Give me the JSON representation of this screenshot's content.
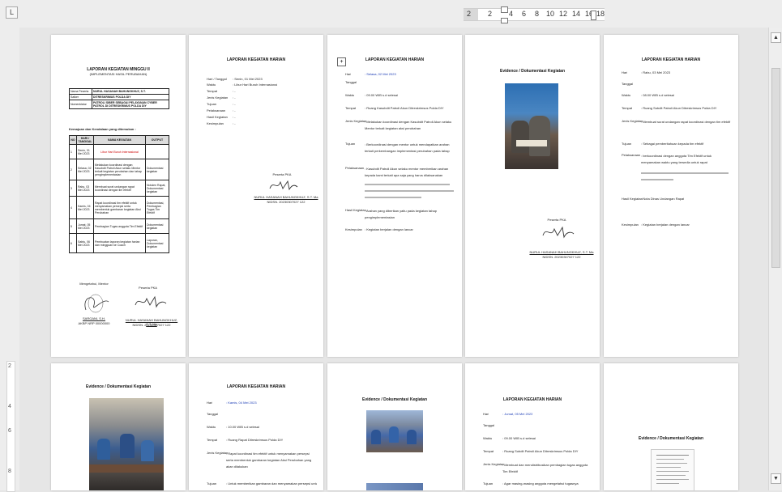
{
  "ruler": {
    "tab_selector": "L",
    "top_numbers": [
      "2",
      "2",
      "4",
      "6",
      "8",
      "10",
      "12",
      "14",
      "16",
      "18"
    ],
    "left_numbers": [
      "2",
      "4",
      "6",
      "8"
    ]
  },
  "scrollbar": {
    "up": "▲",
    "down": "▼"
  },
  "pages": {
    "p1": {
      "title1": "LAPORAN KEGIATAN MINGGU II",
      "title2": "(IMPLEMENTASI HASIL PERUBAHAN)",
      "id_rows": [
        [
          "Nama Peserta",
          "NURUL HASANAH BAHUNGKHUZ, S.T."
        ],
        [
          "Satker",
          "DITRESKRIMUS POLDA DIY"
        ],
        [
          "Nomenklatur",
          "PATROLI SIBER SEBAGAI PELAYANAN CYBER PATROL DI DITRESKRIMUS POLDA DIY"
        ]
      ],
      "sub": "Kemajuan dan Kendalaan yang ditemukan :",
      "headers": [
        "NO",
        "HARI / TANGGAL",
        "NAMA KEGIATAN",
        "OUTPUT"
      ],
      "rows": [
        [
          "1",
          "Senin, 01 Mei 2023",
          "Libur Hari Buruh Internasional",
          ""
        ],
        [
          "2",
          "Selasa, 02 Mei 2023",
          "Melakukan koordinasi dengan Kasubdit Patroli Akun selaku Mentor terkait kegiatan perubahan dan tahap pengimplementasian",
          "Dokumentasi kegiatan"
        ],
        [
          "3",
          "Rabu, 03 Mei 2023",
          "Membuat surat undangan rapat koordinasi dengan tim efektif",
          "Notulen Rapat, Dokumentasi kegiatan"
        ],
        [
          "4",
          "Kamis, 04 Mei 2023",
          "Rapat koordinasi tim efektif untuk menyamakan persepsi serta membentuk gambaran kegiatan Aksi Perubahan",
          "Dokumentasi, Pembagian Tugas Tim Efektif"
        ],
        [
          "5",
          "Jumat, 05 Mei 2023",
          "Pembagian Tugas anggota Tim Efektif",
          "Dokumentasi kegiatan"
        ],
        [
          "6",
          "Sabtu, 06 Mei 2023",
          "Pembuatan laporan kegiatan harian dan mingguan ke Coach",
          "Laporan, Dokumentasi kegiatan"
        ]
      ],
      "sign_left": "Mengetahui, Mentor",
      "sign_right": "Peserta PKA",
      "name_left": "SARGANI, S.H.",
      "nrp_left": "AKBP NRP 00000000",
      "name_right": "NURUL HASANAH BAHUNGKHUZ, S.T. Ma",
      "nrp_right": "NIDSN. 20230307027 122"
    },
    "p2": {
      "title": "LAPORAN KEGIATAN HARIAN",
      "fields": [
        [
          "Hari / Tanggal",
          ": Senin, 01 Mei 2023"
        ],
        [
          "Waktu",
          ": Libur Hari Buruh Internasional"
        ],
        [
          "Tempat",
          ": -"
        ],
        [
          "Jenis Kegiatan",
          ": -"
        ],
        [
          "Tujuan",
          ": -"
        ],
        [
          "Pelaksanaan",
          ": -"
        ],
        [
          "Hasil Kegiatan",
          ": -"
        ],
        [
          "Kesimpulan",
          ": -"
        ]
      ],
      "signer_label": "Peserta PKA",
      "signer_name": "NURUL HASANAH BAHUNGKHUZ, S.T. Ma",
      "signer_nrp": "NIDSN. 20230307027 122"
    },
    "p3": {
      "title": "LAPORAN KEGIATAN HARIAN",
      "fields": [
        [
          "Hari",
          ": Selasa, 02 Mei 2023"
        ],
        [
          "Tanggal",
          ""
        ],
        [
          "Waktu",
          ": 09.00 WIB s.d selesai"
        ],
        [
          "Tempat",
          ": Ruang Kasubdit Patroli Akun Ditreskrimsus Polda DIY"
        ],
        [
          "Jenis Kegiatan",
          ": Melakukan koordinasi dengan Kasubdit Patroli Akun selaku Mentor terkait kegiatan aksi perubahan"
        ],
        [
          "Tujuan",
          ": Berkoordinasi dengan mentor untuk mendapatkan arahan terkait perkembangan implementasi perubahan pada tahap pengimplementasian"
        ],
        [
          "Pelaksanaan",
          ": Kasubdit Patroli Akun selaku mentor memberikan arahan kepada kami terkait apa saja yang harus dilaksanakan"
        ],
        [
          "Hasil Kegiatan",
          ": Arahan yang diberikan yaitu pada kegiatan tahap pengimplementasian"
        ],
        [
          "Kesimpulan",
          ": Kegiatan berjalan dengan lancar"
        ]
      ],
      "icon_label": "+"
    },
    "p4": {
      "title": "Evidence / Dokumentasi Kegiatan",
      "signer_label": "Peserta PKA",
      "signer_name": "NURUL HASANAH BAHUNGKHUZ, S.T. Ma",
      "signer_nrp": "NIDSN. 20230307027 122"
    },
    "p5": {
      "title": "LAPORAN KEGIATAN HARIAN",
      "fields": [
        [
          "Hari",
          ": Rabu, 03 Mei 2023"
        ],
        [
          "Tanggal",
          ""
        ],
        [
          "Waktu",
          ": 08.00 WIB s.d selesai"
        ],
        [
          "Tempat",
          ": Ruang Subdit Patroli Akun Ditreskrimsus Polda DIY"
        ],
        [
          "Jenis Kegiatan",
          ": Membuat surat undangan rapat koordinasi dengan tim efektif"
        ],
        [
          "Tujuan",
          ": Sebagai pemberitahuan kepada tim efektif"
        ],
        [
          "Pelaksanaan",
          ": berkoordinasi dengan anggota Tim Efektif untuk menyamakan waktu yang tersedia untuk rapat"
        ],
        [
          "Hasil Kegiatan",
          ": Nota Dinas Undangan Rapat"
        ],
        [
          "Kesimpulan",
          ": Kegiatan berjalan dengan lancar"
        ]
      ]
    },
    "p6": {
      "title": "Evidence / Dokumentasi Kegiatan"
    },
    "p7": {
      "title": "LAPORAN KEGIATAN HARIAN",
      "fields": [
        [
          "Hari",
          ": Kamis, 04 Mei 2023"
        ],
        [
          "Tanggal",
          ""
        ],
        [
          "Waktu",
          ": 10.00 WIB s.d selesai"
        ],
        [
          "Tempat",
          ": Ruang Rapat Ditreskrimsus Polda DIY"
        ],
        [
          "Jenis Kegiatan",
          ": Rapat koordinasi tim efektif untuk menyamakan persepsi serta membentuk gambaran kegiatan Aksi Perubahan yang akan dilakukan"
        ],
        [
          "Tujuan",
          ": Untuk memberikan gambaran dan menyamakan persepsi untuk Aksi"
        ]
      ]
    },
    "p8": {
      "title": "Evidence / Dokumentasi Kegiatan"
    },
    "p9": {
      "title": "LAPORAN KEGIATAN HARIAN",
      "fields": [
        [
          "Hari",
          ": Jumat, 05 Mei 2023"
        ],
        [
          "Tanggal",
          ""
        ],
        [
          "Waktu",
          ": 09.00 WIB s.d selesai"
        ],
        [
          "Tempat",
          ": Ruang Subdit Patroli Akun Ditreskrimsus Polda DIY"
        ],
        [
          "Jenis Kegiatan",
          ": Membuat dan mendistribusikan pembagian tugas anggota Tim Efektif"
        ],
        [
          "Tujuan",
          ": Agar masing-masing anggota mengetahui tugasnya"
        ]
      ]
    },
    "p10": {
      "title": "Evidence / Dokumentasi Kegiatan"
    }
  }
}
